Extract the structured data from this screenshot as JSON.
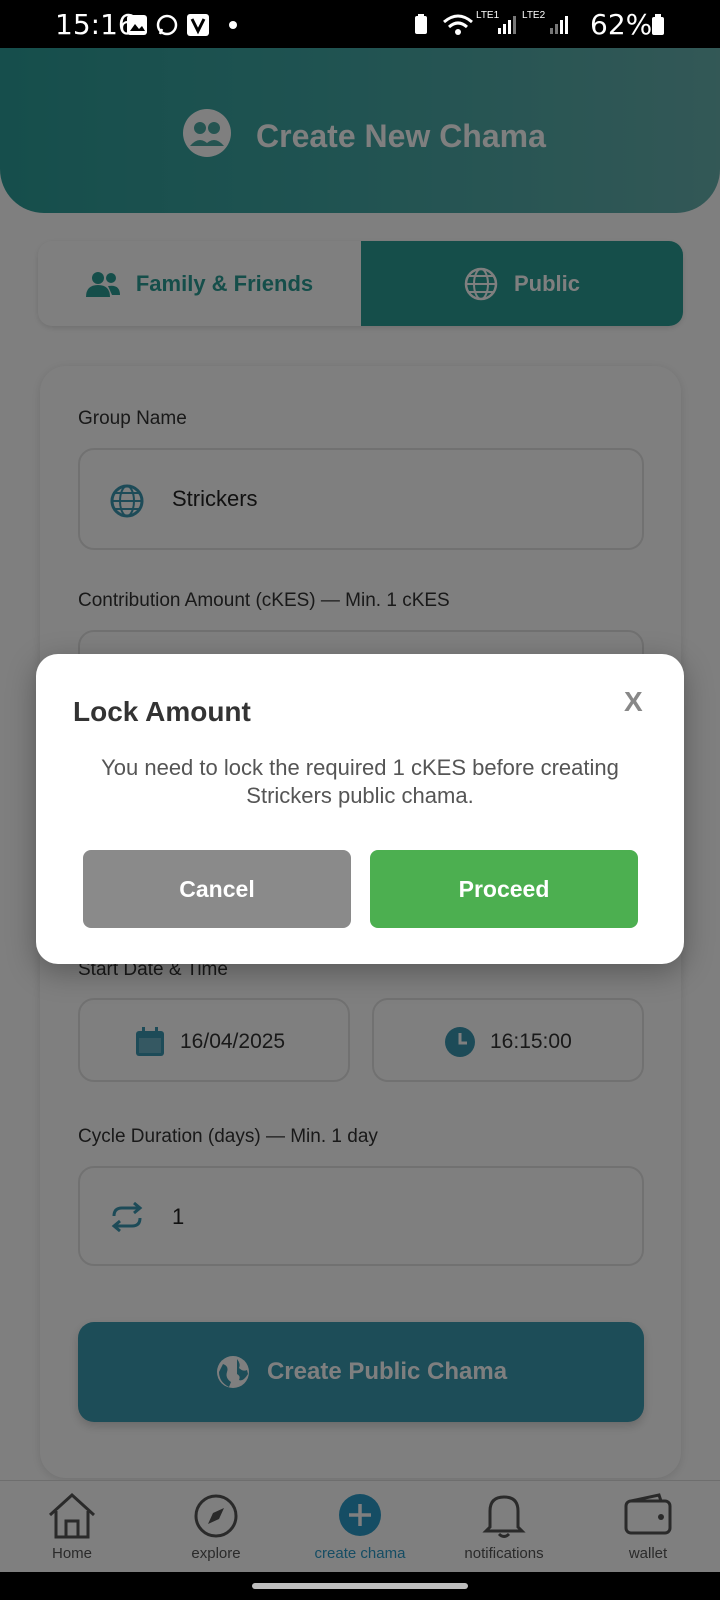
{
  "status_bar": {
    "time": "15:16",
    "battery": "62%",
    "lte1": "LTE1",
    "lte2": "LTE2"
  },
  "header": {
    "title": "Create New Chama",
    "icon": "group-icon"
  },
  "tabs": [
    {
      "label": "Family & Friends",
      "icon": "people-icon",
      "active": false
    },
    {
      "label": "Public",
      "icon": "globe-icon",
      "active": true
    }
  ],
  "form": {
    "group_name_label": "Group Name",
    "group_name_value": "Strickers",
    "contribution_label": "Contribution Amount (cKES) — Min. 1 cKES",
    "start_label": "Start Date & Time",
    "start_date": "16/04/2025",
    "start_time": "16:15:00",
    "cycle_label": "Cycle Duration (days) — Min. 1 day",
    "cycle_value": "1",
    "submit_label": "Create Public Chama"
  },
  "dialog": {
    "title": "Lock Amount",
    "close": "X",
    "message": "You need to lock the required 1 cKES before creating Strickers public chama.",
    "cancel_label": "Cancel",
    "proceed_label": "Proceed"
  },
  "bottom_nav": [
    {
      "label": "Home",
      "icon": "home-icon"
    },
    {
      "label": "explore",
      "icon": "compass-icon"
    },
    {
      "label": "create chama",
      "icon": "plus-circle-icon",
      "active": true
    },
    {
      "label": "notifications",
      "icon": "bell-icon"
    },
    {
      "label": "wallet",
      "icon": "wallet-icon"
    }
  ],
  "colors": {
    "brand_teal": "#2a9d95",
    "create_button": "#3a9ab1",
    "proceed": "#4caf50",
    "cancel": "#8a8a8a"
  }
}
